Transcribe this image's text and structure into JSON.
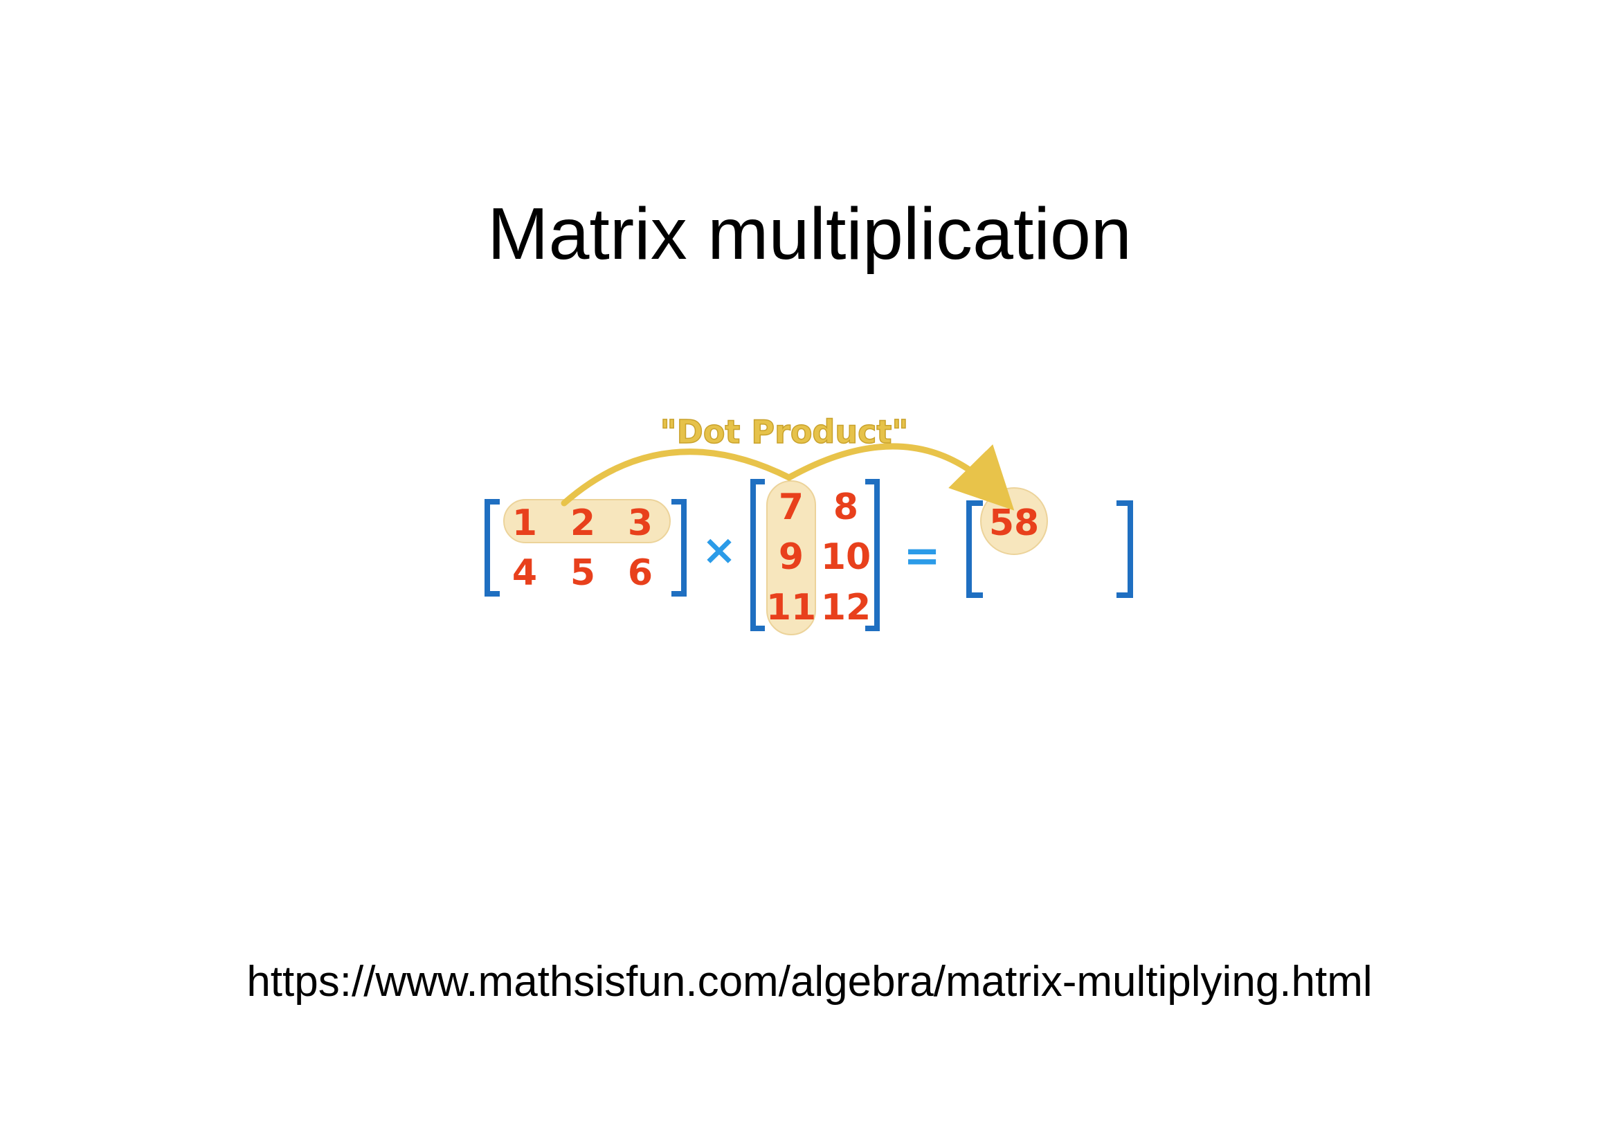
{
  "slide": {
    "title": "Matrix multiplication",
    "source_url": "https://www.mathsisfun.com/algebra/matrix-multiplying.html"
  },
  "diagram": {
    "annotation": "\"Dot Product\"",
    "times_symbol": "×",
    "equals_symbol": "=",
    "matrix_a": [
      [
        "1",
        "2",
        "3"
      ],
      [
        "4",
        "5",
        "6"
      ]
    ],
    "matrix_b": [
      [
        "7",
        "8"
      ],
      [
        "9",
        "10"
      ],
      [
        "11",
        "12"
      ]
    ],
    "result": "58",
    "colors": {
      "numbers": "#e8401c",
      "brackets": "#1f6fc1",
      "operators": "#2b9be8",
      "highlight": "#f7e6bd",
      "arrow": "#e8c34a"
    }
  }
}
